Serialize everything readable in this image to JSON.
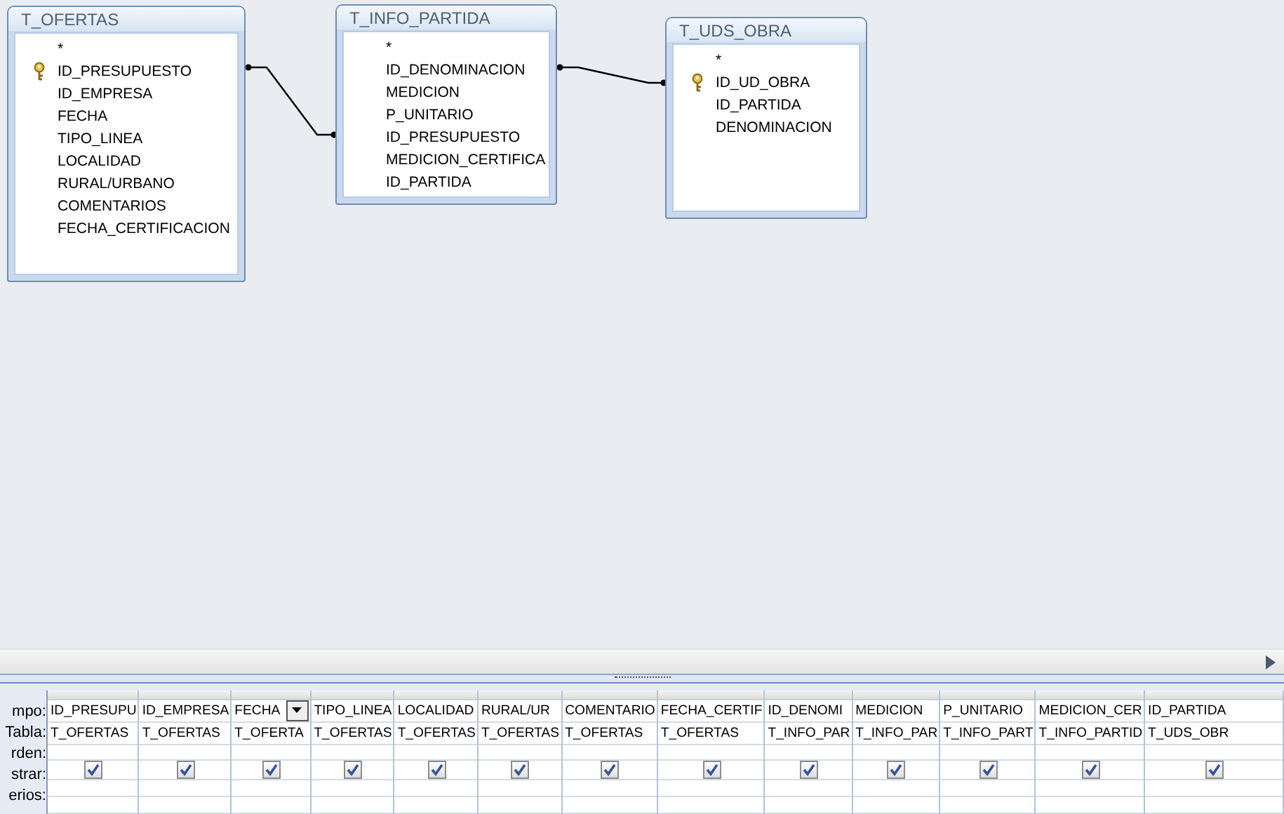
{
  "tables": [
    {
      "title": "T_OFERTAS",
      "fields": [
        {
          "name": "*",
          "key": false
        },
        {
          "name": "ID_PRESUPUESTO",
          "key": true
        },
        {
          "name": "ID_EMPRESA",
          "key": false
        },
        {
          "name": "FECHA",
          "key": false
        },
        {
          "name": "TIPO_LINEA",
          "key": false
        },
        {
          "name": "LOCALIDAD",
          "key": false
        },
        {
          "name": "RURAL/URBANO",
          "key": false
        },
        {
          "name": "COMENTARIOS",
          "key": false
        },
        {
          "name": "FECHA_CERTIFICACION",
          "key": false
        }
      ]
    },
    {
      "title": "T_INFO_PARTIDA",
      "fields": [
        {
          "name": "*",
          "key": false
        },
        {
          "name": "ID_DENOMINACION",
          "key": false
        },
        {
          "name": "MEDICION",
          "key": false
        },
        {
          "name": "P_UNITARIO",
          "key": false
        },
        {
          "name": "ID_PRESUPUESTO",
          "key": false
        },
        {
          "name": "MEDICION_CERTIFICA",
          "key": false
        },
        {
          "name": "ID_PARTIDA",
          "key": false
        }
      ]
    },
    {
      "title": "T_UDS_OBRA",
      "fields": [
        {
          "name": "*",
          "key": false
        },
        {
          "name": "ID_UD_OBRA",
          "key": true
        },
        {
          "name": "ID_PARTIDA",
          "key": false
        },
        {
          "name": "DENOMINACION",
          "key": false
        }
      ]
    }
  ],
  "grid": {
    "row_labels": [
      "mpo:",
      "Tabla:",
      "rden:",
      "strar:",
      "erios:"
    ],
    "columns": [
      {
        "field": "ID_PRESUPU",
        "table": "T_OFERTAS",
        "show": true,
        "active": false
      },
      {
        "field": "ID_EMPRESA",
        "table": "T_OFERTAS",
        "show": true,
        "active": false
      },
      {
        "field": "FECHA",
        "table": "T_OFERTA",
        "show": true,
        "active": true
      },
      {
        "field": "TIPO_LINEA",
        "table": "T_OFERTAS",
        "show": true,
        "active": false
      },
      {
        "field": "LOCALIDAD",
        "table": "T_OFERTAS",
        "show": true,
        "active": false
      },
      {
        "field": "RURAL/UR",
        "table": "T_OFERTAS",
        "show": true,
        "active": false
      },
      {
        "field": "COMENTARIO",
        "table": "T_OFERTAS",
        "show": true,
        "active": false
      },
      {
        "field": "FECHA_CERTIF",
        "table": "T_OFERTAS",
        "show": true,
        "active": false
      },
      {
        "field": "ID_DENOMI",
        "table": "T_INFO_PAR",
        "show": true,
        "active": false
      },
      {
        "field": "MEDICION",
        "table": "T_INFO_PAR",
        "show": true,
        "active": false
      },
      {
        "field": "P_UNITARIO",
        "table": "T_INFO_PART",
        "show": true,
        "active": false
      },
      {
        "field": "MEDICION_CER",
        "table": "T_INFO_PARTID",
        "show": true,
        "active": false
      },
      {
        "field": "ID_PARTIDA",
        "table": "T_UDS_OBR",
        "show": true,
        "active": false
      }
    ]
  }
}
